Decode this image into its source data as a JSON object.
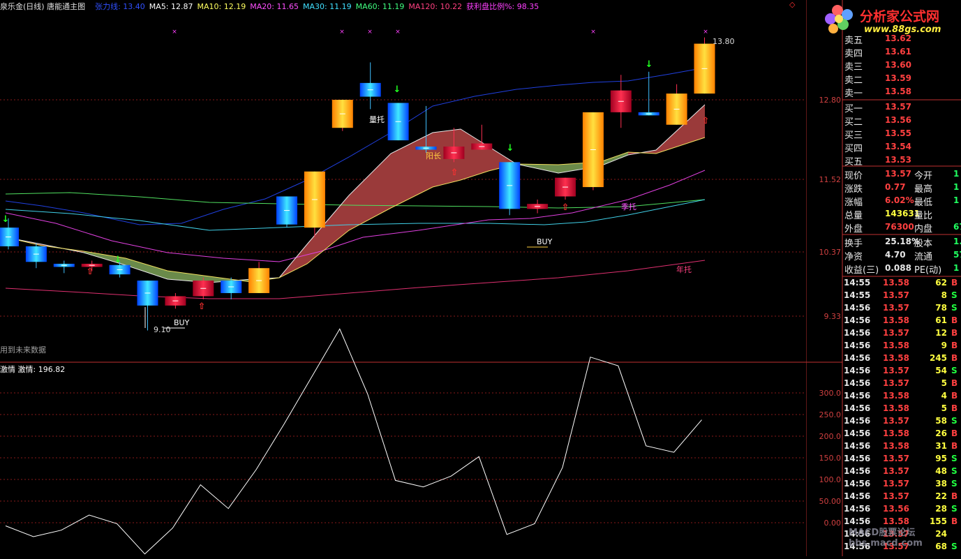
{
  "header": {
    "title": "泉乐金(日线) 唐能通主图",
    "items": [
      {
        "label": "张力线: 13.40",
        "color": "#3050ff"
      },
      {
        "label": "MA5: 12.87",
        "color": "#ffffff"
      },
      {
        "label": "MA10: 12.19",
        "color": "#ffff60"
      },
      {
        "label": "MA20: 11.65",
        "color": "#ff50ff"
      },
      {
        "label": "MA30: 11.19",
        "color": "#40e0ff"
      },
      {
        "label": "MA60: 11.19",
        "color": "#40ff80"
      },
      {
        "label": "MA120: 10.22",
        "color": "#ff4080"
      },
      {
        "label": "获利盘比例%: 98.35",
        "color": "#ff40ff"
      }
    ]
  },
  "price_axis": [
    "12.80",
    "11.52",
    "10.37",
    "9.33"
  ],
  "annotations": {
    "high_price": "13.80",
    "low_price": "9.10",
    "buy1": "BUY",
    "buy2": "BUY",
    "liangtuo": "量托",
    "yangchang": "阳长",
    "jituo": "季托",
    "niantuo": "年托",
    "future_note": "用到未来数据"
  },
  "sub_chart": {
    "title": "激情 激情: 196.82",
    "axis": [
      "300.0",
      "250.0",
      "200.0",
      "150.0",
      "100.0",
      "50.00",
      "0.00"
    ]
  },
  "logo": {
    "name": "分析家公式网",
    "url": "www.88gs.com"
  },
  "watermark": "MACD股票论坛 bbs.macd.com",
  "quotes": {
    "asks": [
      {
        "label": "卖五",
        "value": "13.62"
      },
      {
        "label": "卖四",
        "value": "13.61"
      },
      {
        "label": "卖三",
        "value": "13.60"
      },
      {
        "label": "卖二",
        "value": "13.59"
      },
      {
        "label": "卖一",
        "value": "13.58"
      }
    ],
    "bids": [
      {
        "label": "买一",
        "value": "13.57"
      },
      {
        "label": "买二",
        "value": "13.56"
      },
      {
        "label": "买三",
        "value": "13.55"
      },
      {
        "label": "买四",
        "value": "13.54"
      },
      {
        "label": "买五",
        "value": "13.53"
      }
    ],
    "stats": [
      {
        "label": "现价",
        "value": "13.57",
        "color": "#ff4040",
        "label2": "今开",
        "value2": "1"
      },
      {
        "label": "涨跌",
        "value": "0.77",
        "color": "#ff4040",
        "label2": "最高",
        "value2": "1"
      },
      {
        "label": "涨幅",
        "value": "6.02%",
        "color": "#ff4040",
        "label2": "最低",
        "value2": "1"
      },
      {
        "label": "总量",
        "value": "143631",
        "color": "#ffff40",
        "label2": "量比",
        "value2": ""
      },
      {
        "label": "外盘",
        "value": "76300",
        "color": "#ff4040",
        "label2": "内盘",
        "value2": "67"
      }
    ],
    "stats2": [
      {
        "label": "换手",
        "value": "25.18%",
        "color": "#e8e8e8",
        "label2": "股本",
        "value2": "1."
      },
      {
        "label": "净资",
        "value": "4.70",
        "color": "#e8e8e8",
        "label2": "流通",
        "value2": "57("
      },
      {
        "label": "收益(三)",
        "value": "0.088",
        "color": "#e8e8e8",
        "label2": "PE(动)",
        "value2": "1"
      }
    ]
  },
  "ticks": [
    {
      "time": "14:55",
      "price": "13.58",
      "vol": "62",
      "side": "B"
    },
    {
      "time": "14:55",
      "price": "13.57",
      "vol": "8",
      "side": "S"
    },
    {
      "time": "14:56",
      "price": "13.57",
      "vol": "78",
      "side": "S"
    },
    {
      "time": "14:56",
      "price": "13.58",
      "vol": "61",
      "side": "B"
    },
    {
      "time": "14:56",
      "price": "13.57",
      "vol": "12",
      "side": "B"
    },
    {
      "time": "14:56",
      "price": "13.58",
      "vol": "9",
      "side": "B"
    },
    {
      "time": "14:56",
      "price": "13.58",
      "vol": "245",
      "side": "B"
    },
    {
      "time": "14:56",
      "price": "13.57",
      "vol": "54",
      "side": "S"
    },
    {
      "time": "14:56",
      "price": "13.57",
      "vol": "5",
      "side": "B"
    },
    {
      "time": "14:56",
      "price": "13.58",
      "vol": "4",
      "side": "B"
    },
    {
      "time": "14:56",
      "price": "13.58",
      "vol": "5",
      "side": "B"
    },
    {
      "time": "14:56",
      "price": "13.57",
      "vol": "58",
      "side": "S"
    },
    {
      "time": "14:56",
      "price": "13.58",
      "vol": "26",
      "side": "B"
    },
    {
      "time": "14:56",
      "price": "13.58",
      "vol": "31",
      "side": "B"
    },
    {
      "time": "14:56",
      "price": "13.57",
      "vol": "95",
      "side": "S"
    },
    {
      "time": "14:56",
      "price": "13.57",
      "vol": "48",
      "side": "S"
    },
    {
      "time": "14:56",
      "price": "13.57",
      "vol": "38",
      "side": "S"
    },
    {
      "time": "14:56",
      "price": "13.57",
      "vol": "22",
      "side": "B"
    },
    {
      "time": "14:56",
      "price": "13.56",
      "vol": "28",
      "side": "S"
    },
    {
      "time": "14:56",
      "price": "13.58",
      "vol": "155",
      "side": "B"
    },
    {
      "time": "14:56",
      "price": "13.57",
      "vol": "24",
      "side": ""
    },
    {
      "time": "14:56",
      "price": "13.57",
      "vol": "68",
      "side": "S"
    }
  ],
  "candles": [
    {
      "o": 10.75,
      "c": 10.45,
      "h": 10.9,
      "l": 10.4,
      "up": false
    },
    {
      "o": 10.45,
      "c": 10.2,
      "h": 10.5,
      "l": 10.1,
      "up": false
    },
    {
      "o": 10.17,
      "c": 10.12,
      "h": 10.22,
      "l": 10.02,
      "up": false
    },
    {
      "o": 10.12,
      "c": 10.17,
      "h": 10.22,
      "l": 10.05,
      "up": true
    },
    {
      "o": 10.15,
      "c": 10.0,
      "h": 10.2,
      "l": 9.95,
      "up": false
    },
    {
      "o": 9.9,
      "c": 9.5,
      "h": 9.9,
      "l": 9.1,
      "up": false
    },
    {
      "o": 9.5,
      "c": 9.65,
      "h": 9.7,
      "l": 9.45,
      "up": true
    },
    {
      "o": 9.65,
      "c": 9.9,
      "h": 9.95,
      "l": 9.6,
      "up": true
    },
    {
      "o": 9.9,
      "c": 9.7,
      "h": 9.95,
      "l": 9.6,
      "up": false
    },
    {
      "o": 9.7,
      "c": 10.1,
      "h": 10.2,
      "l": 9.7,
      "up": true
    },
    {
      "o": 10.8,
      "c": 11.25,
      "h": 11.25,
      "l": 10.75,
      "up": false
    },
    {
      "o": 10.75,
      "c": 11.65,
      "h": 11.65,
      "l": 10.6,
      "up": true
    },
    {
      "o": 12.35,
      "c": 12.8,
      "h": 12.8,
      "l": 12.3,
      "up": true
    },
    {
      "o": 13.07,
      "c": 12.85,
      "h": 13.4,
      "l": 12.65,
      "up": false
    },
    {
      "o": 12.75,
      "c": 12.15,
      "h": 12.75,
      "l": 12.15,
      "up": false
    },
    {
      "o": 12.05,
      "c": 12.0,
      "h": 12.7,
      "l": 11.95,
      "up": false
    },
    {
      "o": 11.85,
      "c": 12.05,
      "h": 12.35,
      "l": 11.8,
      "up": true
    },
    {
      "o": 12.0,
      "c": 12.1,
      "h": 12.4,
      "l": 12.0,
      "up": true
    },
    {
      "o": 11.8,
      "c": 11.05,
      "h": 11.8,
      "l": 10.95,
      "up": false
    },
    {
      "o": 11.05,
      "c": 11.13,
      "h": 11.2,
      "l": 10.98,
      "up": true
    },
    {
      "o": 11.25,
      "c": 11.55,
      "h": 11.55,
      "l": 11.2,
      "up": true
    },
    {
      "o": 11.4,
      "c": 12.6,
      "h": 12.6,
      "l": 11.35,
      "up": true
    },
    {
      "o": 12.6,
      "c": 12.95,
      "h": 13.2,
      "l": 12.35,
      "up": true
    },
    {
      "o": 12.6,
      "c": 12.55,
      "h": 13.25,
      "l": 12.55,
      "up": false
    },
    {
      "o": 12.4,
      "c": 12.9,
      "h": 13.05,
      "l": 12.4,
      "up": true
    },
    {
      "o": 12.9,
      "c": 13.7,
      "h": 13.8,
      "l": 12.9,
      "up": true
    }
  ],
  "jiqing": [
    25,
    0,
    15,
    50,
    30,
    -40,
    20,
    120,
    65,
    155,
    260,
    370,
    480,
    330,
    130,
    115,
    140,
    185,
    5,
    30,
    160,
    415,
    395,
    210,
    195,
    270
  ]
}
